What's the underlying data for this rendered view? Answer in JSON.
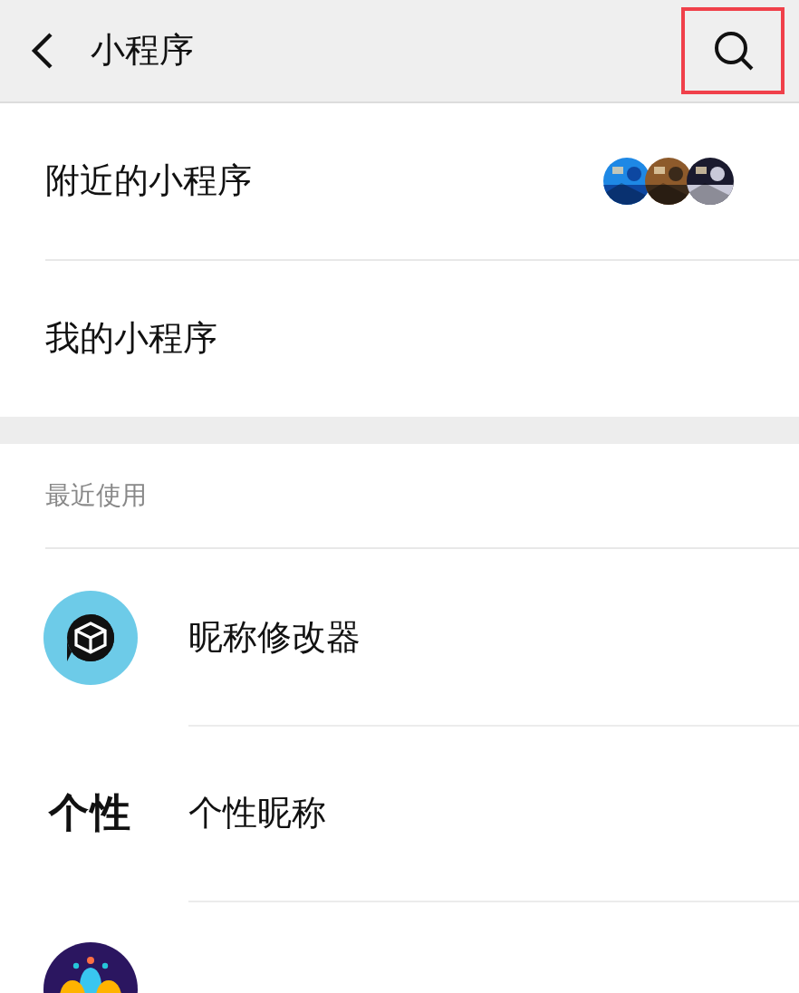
{
  "header": {
    "title": "小程序",
    "search": {
      "highlighted": true
    }
  },
  "menu": [
    {
      "label": "附近的小程序"
    },
    {
      "label": "我的小程序"
    }
  ],
  "recent": {
    "heading": "最近使用",
    "apps": [
      {
        "name": "昵称修改器",
        "kind": "badge"
      },
      {
        "name": "个性昵称",
        "kind": "wordmark",
        "logo_text": "个性"
      },
      {
        "kind": "flower"
      }
    ]
  }
}
